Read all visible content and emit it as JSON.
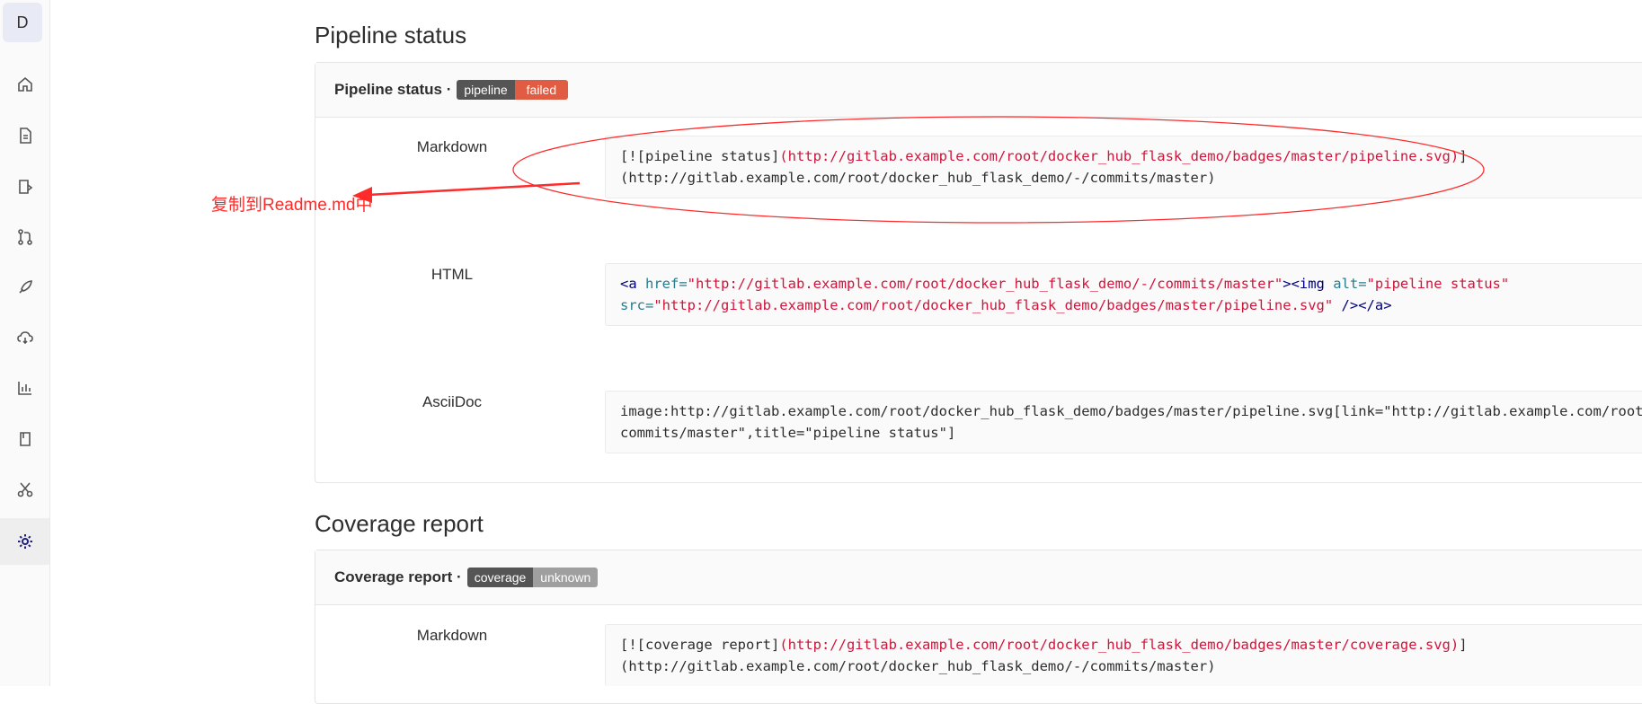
{
  "sidebar": {
    "avatar_letter": "D",
    "items": [
      {
        "icon": "home-icon"
      },
      {
        "icon": "file-icon"
      },
      {
        "icon": "issues-icon"
      },
      {
        "icon": "merge-request-icon"
      },
      {
        "icon": "rocket-icon"
      },
      {
        "icon": "cloud-icon"
      },
      {
        "icon": "chart-icon"
      },
      {
        "icon": "book-icon"
      },
      {
        "icon": "scissors-icon"
      },
      {
        "icon": "gear-icon",
        "active": true
      }
    ]
  },
  "pipeline": {
    "section_title": "Pipeline status",
    "panel_title": "Pipeline status ·",
    "badge_left": "pipeline",
    "badge_right": "failed",
    "markdown_label": "Markdown",
    "markdown_alt": "[![pipeline status]",
    "markdown_url": "(http://gitlab.example.com/root/docker_hub_flask_demo/badges/master/pipeline.svg)",
    "markdown_end": "]",
    "markdown_line2": "(http://gitlab.example.com/root/docker_hub_flask_demo/-/commits/master)",
    "html_label": "HTML",
    "html_tag_open": "<a",
    "html_attr_href": " href=",
    "html_href_val": "\"http://gitlab.example.com/root/docker_hub_flask_demo/-/commits/master\"",
    "html_img_open": "><img",
    "html_attr_alt": " alt=",
    "html_alt_val": "\"pipeline status\"",
    "html_attr_src": "src=",
    "html_src_val": "\"http://gitlab.example.com/root/docker_hub_flask_demo/badges/master/pipeline.svg\"",
    "html_close": " /></a>",
    "asciidoc_label": "AsciiDoc",
    "asciidoc_line1": "image:http://gitlab.example.com/root/docker_hub_flask_demo/badges/master/pipeline.svg[link=\"http://gitlab.example.com/root/docker_hub_flask_demo/-/",
    "asciidoc_line2": "commits/master\",title=\"pipeline status\"]"
  },
  "coverage": {
    "section_title": "Coverage report",
    "panel_title": "Coverage report ·",
    "badge_left": "coverage",
    "badge_right": "unknown",
    "markdown_label": "Markdown",
    "markdown_alt": "[![coverage report]",
    "markdown_url": "(http://gitlab.example.com/root/docker_hub_flask_demo/badges/master/coverage.svg)",
    "markdown_end": "]",
    "markdown_line2": "(http://gitlab.example.com/root/docker_hub_flask_demo/-/commits/master)"
  },
  "annotation": {
    "text": "复制到Readme.md中",
    "color": "#ff2a2a"
  }
}
